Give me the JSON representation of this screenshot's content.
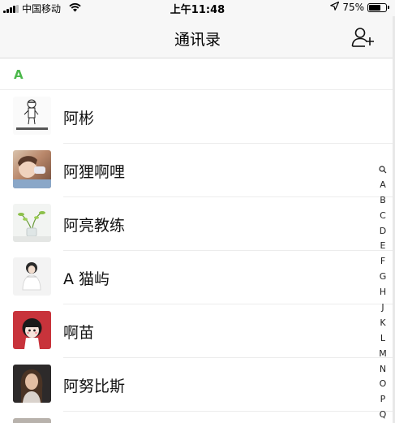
{
  "status_bar": {
    "carrier": "中国移动",
    "time": "上午11:48",
    "battery_percent": "75%",
    "battery_level": 0.75,
    "icons": [
      "signal-icon",
      "wifi-icon",
      "location-arrow-icon",
      "battery-icon"
    ]
  },
  "nav": {
    "title": "通讯录",
    "add_contact_icon": "add-contact-icon"
  },
  "section": {
    "letter": "A"
  },
  "contacts": [
    {
      "name": "阿彬",
      "avatar": "sketch-figure-avatar"
    },
    {
      "name": "阿狸啊哩",
      "avatar": "child-photo-avatar"
    },
    {
      "name": "阿亮教练",
      "avatar": "plant-vase-avatar"
    },
    {
      "name": "A 猫屿",
      "avatar": "girl-portrait-avatar"
    },
    {
      "name": "啊苗",
      "avatar": "cartoon-girl-avatar"
    },
    {
      "name": "阿努比斯",
      "avatar": "woman-portrait-avatar"
    }
  ],
  "index_bar": {
    "search_icon": "search-icon",
    "letters": [
      "A",
      "B",
      "C",
      "D",
      "E",
      "F",
      "G",
      "H",
      "J",
      "K",
      "L",
      "M",
      "N",
      "O",
      "P",
      "Q"
    ]
  },
  "colors": {
    "accent_green": "#4cb84c",
    "nav_background": "#f7f7f7",
    "divider": "#ececec"
  }
}
